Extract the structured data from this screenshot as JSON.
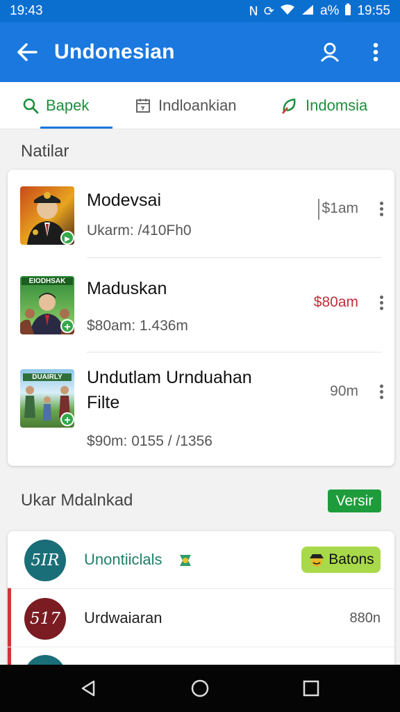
{
  "status_bar": {
    "time_left": "19:43",
    "time_right": "19:55",
    "battery": "a%"
  },
  "app_bar": {
    "title": "Undonesian",
    "back_icon": "arrow-back-icon",
    "profile_icon": "person-icon",
    "menu_icon": "more-vert-icon"
  },
  "tabs": [
    {
      "label": "Bapek",
      "icon": "search-icon",
      "active": true
    },
    {
      "label": "Indloankian",
      "icon": "calendar-icon",
      "active": false
    },
    {
      "label": "Indomsia",
      "icon": "leaf-icon",
      "active": false
    }
  ],
  "section1": {
    "title": "Natilar"
  },
  "list": [
    {
      "name": "Modevsai",
      "meta": "Ukarm: /410Fh0",
      "time": "$1am",
      "time_color": "#666666"
    },
    {
      "name": "Maduskan",
      "meta": "$80am: 1.436m",
      "time": "$80am",
      "time_color": "#c0303a",
      "thumb_caption": "EIODHSAK"
    },
    {
      "name_line1": "Undutlam Urnduahan",
      "name_line2": "Filte",
      "meta": "$90m: 0155 / /1356",
      "time": "90m",
      "time_color": "#666666",
      "thumb_caption": "DUAIRLY"
    }
  ],
  "section2": {
    "title": "Ukar Mdalnkad",
    "chip": "Versir"
  },
  "list2": [
    {
      "avatar": "5IR",
      "label": "Unontiiclals",
      "tag": "Batons",
      "avatar_color": "#1a6e78",
      "label_color": "#1f7f6a"
    },
    {
      "avatar": "517",
      "label": "Urdwaiaran",
      "value": "880n",
      "avatar_color": "#7a1c22",
      "label_color": "#222222"
    }
  ],
  "colors": {
    "primary": "#1a78de",
    "accent_green": "#1e8e3e",
    "red": "#d03535"
  }
}
